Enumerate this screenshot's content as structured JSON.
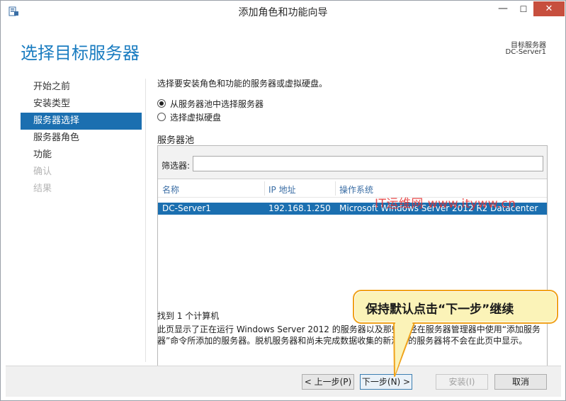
{
  "window": {
    "title": "添加角色和功能向导",
    "minimize_glyph": "—",
    "maximize_glyph": "☐",
    "close_glyph": "✕"
  },
  "header": {
    "page_title": "选择目标服务器",
    "destination_label": "目标服务器",
    "destination_server": "DC-Server1"
  },
  "nav": {
    "items": [
      {
        "label": "开始之前",
        "state": "normal"
      },
      {
        "label": "安装类型",
        "state": "normal"
      },
      {
        "label": "服务器选择",
        "state": "active"
      },
      {
        "label": "服务器角色",
        "state": "normal"
      },
      {
        "label": "功能",
        "state": "normal"
      },
      {
        "label": "确认",
        "state": "disabled"
      },
      {
        "label": "结果",
        "state": "disabled"
      }
    ]
  },
  "content": {
    "instruction": "选择要安装角色和功能的服务器或虚拟硬盘。",
    "radio_pool": "从服务器池中选择服务器",
    "radio_vhd": "选择虚拟硬盘",
    "pool_label": "服务器池",
    "filter_label": "筛选器:",
    "filter_value": "",
    "columns": [
      "名称",
      "IP 地址",
      "操作系统"
    ],
    "rows": [
      {
        "name": "DC-Server1",
        "ip": "192.168.1.250",
        "os": "Microsoft Windows Server 2012 R2 Datacenter"
      }
    ],
    "found_text": "找到 1 个计算机",
    "description": "此页显示了正在运行 Windows Server 2012 的服务器以及那些已经在服务器管理器中使用“添加服务器”命令所添加的服务器。脱机服务器和尚未完成数据收集的新添加的服务器将不会在此页中显示。"
  },
  "watermark": "IT运维网 www.ityww.cn",
  "callout": "保持默认点击“下一步”继续",
  "footer": {
    "prev": "< 上一步(P)",
    "next": "下一步(N) >",
    "install": "安装(I)",
    "cancel": "取消"
  },
  "colors": {
    "accent": "#1b6fb0",
    "title_blue": "#1a7cc0",
    "close_red": "#c74f3e",
    "callout_fill": "#fbf3b8",
    "callout_border": "#f0a21a",
    "watermark": "#e52f2f"
  }
}
